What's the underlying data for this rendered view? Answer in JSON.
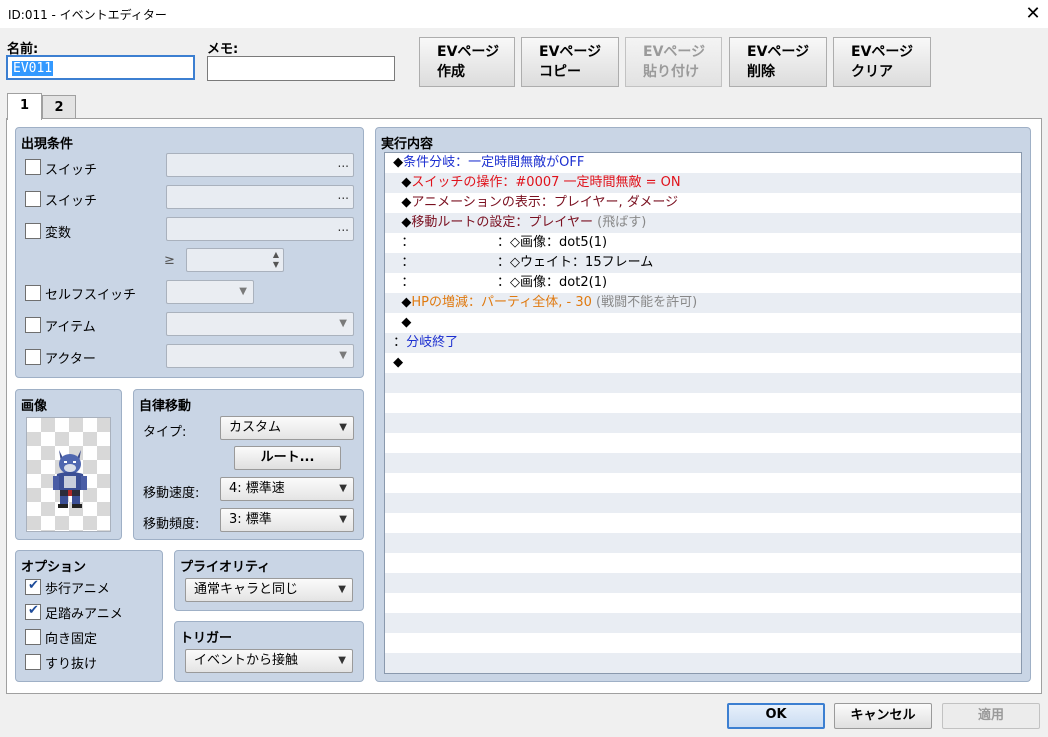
{
  "window": {
    "title": "ID:011 - イベントエディター",
    "close_glyph": "✕"
  },
  "header": {
    "name_label": "名前:",
    "name_value": "EV011",
    "memo_label": "メモ:",
    "memo_value": "",
    "buttons": [
      {
        "line1": "EVページ",
        "line2": "作成",
        "enabled": true
      },
      {
        "line1": "EVページ",
        "line2": "コピー",
        "enabled": true
      },
      {
        "line1": "EVページ",
        "line2": "貼り付け",
        "enabled": false
      },
      {
        "line1": "EVページ",
        "line2": "削除",
        "enabled": true
      },
      {
        "line1": "EVページ",
        "line2": "クリア",
        "enabled": true
      }
    ]
  },
  "tabs": [
    {
      "label": "1",
      "active": true
    },
    {
      "label": "2",
      "active": false
    }
  ],
  "conditions": {
    "title": "出現条件",
    "switch1": "スイッチ",
    "switch2": "スイッチ",
    "variable": "変数",
    "gte": "≥",
    "self_switch": "セルフスイッチ",
    "item": "アイテム",
    "actor": "アクター",
    "dots": "..."
  },
  "image": {
    "title": "画像",
    "icon": "werewolf-sprite"
  },
  "autonomous": {
    "title": "自律移動",
    "type_label": "タイプ:",
    "type_value": "カスタム",
    "route_button": "ルート...",
    "speed_label": "移動速度:",
    "speed_value": "4: 標準速",
    "freq_label": "移動頻度:",
    "freq_value": "3: 標準"
  },
  "options": {
    "title": "オプション",
    "walking": {
      "label": "歩行アニメ",
      "checked": true
    },
    "stepping": {
      "label": "足踏みアニメ",
      "checked": true
    },
    "direction_fix": {
      "label": "向き固定",
      "checked": false
    },
    "through": {
      "label": "すり抜け",
      "checked": false
    }
  },
  "priority": {
    "title": "プライオリティ",
    "value": "通常キャラと同じ"
  },
  "trigger": {
    "title": "トリガー",
    "value": "イベントから接触"
  },
  "contents": {
    "title": "実行内容",
    "lines": [
      {
        "indent": "",
        "parts": [
          {
            "t": "◆",
            "c": "black"
          },
          {
            "t": "条件分岐：一定時間無敵がOFF",
            "c": "blue"
          }
        ]
      },
      {
        "indent": "  ",
        "parts": [
          {
            "t": "◆",
            "c": "black"
          },
          {
            "t": "スイッチの操作：#0007 一定時間無敵 = ON",
            "c": "red"
          }
        ]
      },
      {
        "indent": "  ",
        "parts": [
          {
            "t": "◆",
            "c": "black"
          },
          {
            "t": "アニメーションの表示：プレイヤー, ダメージ",
            "c": "dark"
          }
        ]
      },
      {
        "indent": "  ",
        "parts": [
          {
            "t": "◆",
            "c": "black"
          },
          {
            "t": "移動ルートの設定：プレイヤー",
            "c": "dark"
          },
          {
            "t": " (飛ばす)",
            "c": "gray"
          }
        ]
      },
      {
        "indent": "  ",
        "parts": [
          {
            "t": "：                    ：◇画像：dot5(1)",
            "c": "black"
          }
        ]
      },
      {
        "indent": "  ",
        "parts": [
          {
            "t": "：                    ：◇ウェイト：15フレーム",
            "c": "black"
          }
        ]
      },
      {
        "indent": "  ",
        "parts": [
          {
            "t": "：                    ：◇画像：dot2(1)",
            "c": "black"
          }
        ]
      },
      {
        "indent": "  ",
        "parts": [
          {
            "t": "◆",
            "c": "black"
          },
          {
            "t": "HPの増減：パーティ全体, - 30",
            "c": "orange"
          },
          {
            "t": " (戦闘不能を許可)",
            "c": "gray"
          }
        ]
      },
      {
        "indent": "  ",
        "parts": [
          {
            "t": "◆",
            "c": "black"
          }
        ]
      },
      {
        "indent": "",
        "parts": [
          {
            "t": "：",
            "c": "black"
          },
          {
            "t": "分岐終了",
            "c": "blue"
          }
        ]
      },
      {
        "indent": "",
        "parts": [
          {
            "t": "◆",
            "c": "black"
          }
        ]
      }
    ],
    "total_rows": 26
  },
  "footer": {
    "ok": "OK",
    "cancel": "キャンセル",
    "apply": "適用"
  },
  "colors": {
    "group_bg": "#c9d5e5",
    "accent": "#3c7fd1"
  }
}
